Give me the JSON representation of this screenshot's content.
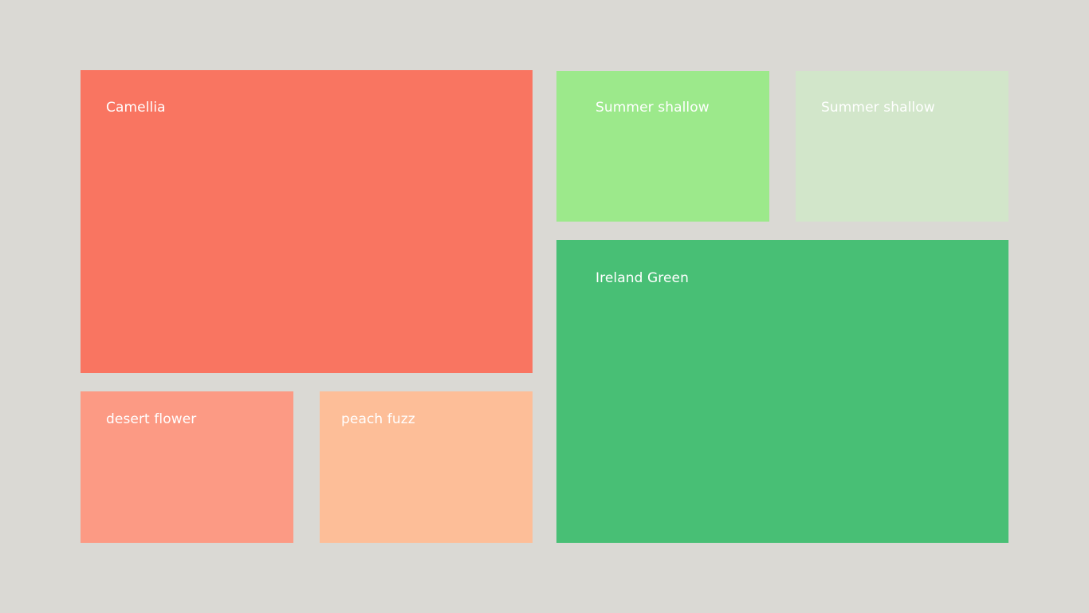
{
  "background": "#dad9d4",
  "text_color": "#ffffff",
  "tiles": [
    {
      "label": "Camellia",
      "color": "#f97561"
    },
    {
      "label": "desert flower",
      "color": "#fc9a84"
    },
    {
      "label": "peach fuzz",
      "color": "#fdbe98"
    },
    {
      "label": "Summer shallow",
      "color": "#9ce98b"
    },
    {
      "label": "Summer shallow",
      "color": "#d2e6ca"
    },
    {
      "label": "Ireland Green",
      "color": "#48bf75"
    }
  ]
}
